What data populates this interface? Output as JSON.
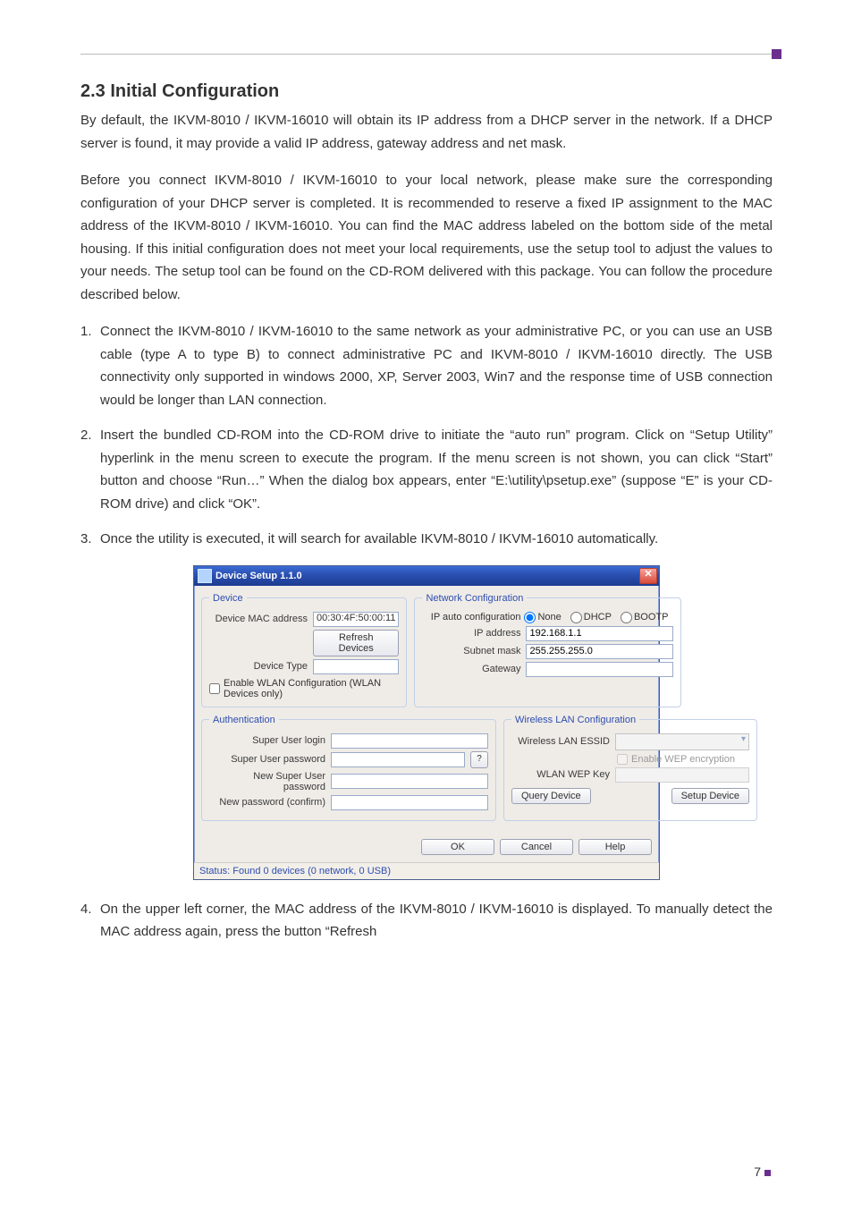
{
  "section": {
    "heading": "2.3 Initial Configuration",
    "para1": "By default, the IKVM-8010 / IKVM-16010 will obtain its IP address from a DHCP server in the network. If a DHCP server is found, it may provide a valid IP address, gateway address and net mask.",
    "para2": "Before you connect IKVM-8010 / IKVM-16010 to your local network, please make sure the corresponding configuration of your DHCP server is completed. It is recommended to reserve a fixed IP assignment to the MAC address of the IKVM-8010 / IKVM-16010. You can find the MAC address labeled on the bottom side of the metal housing. If this initial configuration does not meet your local requirements, use the setup tool to adjust the values to your needs. The setup tool can be found on the CD-ROM delivered with this package. You can follow the procedure described below.",
    "step1": "Connect the IKVM-8010 / IKVM-16010 to the same network as your administrative PC, or you can use an USB cable (type A to type B) to connect administrative PC and IKVM-8010 / IKVM-16010 directly. The USB connectivity only supported in windows 2000, XP, Server 2003, Win7 and the response time of USB connection would be longer than LAN connection.",
    "step2": "Insert the bundled CD-ROM into the CD-ROM drive to initiate the “auto run” program. Click on “Setup Utility” hyperlink in the menu screen to execute the program. If the menu screen is not shown, you can click “Start” button and choose “Run…” When the dialog box appears, enter “E:\\utility\\psetup.exe” (suppose “E” is your CD-ROM drive) and click “OK”.",
    "step3": "Once the utility is executed, it will search for available IKVM-8010 / IKVM-16010 automatically.",
    "step4": "On the upper left corner, the MAC address of the IKVM-8010 / IKVM-16010 is displayed. To manually detect the MAC address again, press the button “Refresh"
  },
  "app": {
    "title": "Device Setup 1.1.0",
    "status": "Status: Found 0 devices (0 network, 0 USB)",
    "device": {
      "legend": "Device",
      "mac_label": "Device MAC address",
      "mac_value": "00:30:4F:50:00:11",
      "refresh_btn": "Refresh Devices",
      "type_label": "Device Type",
      "type_value": "",
      "wlan_enable_label": "Enable WLAN Configuration (WLAN Devices only)"
    },
    "network": {
      "legend": "Network Configuration",
      "autoconf_label": "IP auto configuration",
      "opt_none": "None",
      "opt_dhcp": "DHCP",
      "opt_bootp": "BOOTP",
      "ip_label": "IP address",
      "ip_value": "192.168.1.1",
      "mask_label": "Subnet mask",
      "mask_value": "255.255.255.0",
      "gw_label": "Gateway",
      "gw_value": ""
    },
    "auth": {
      "legend": "Authentication",
      "login_label": "Super User login",
      "pw_label": "Super User password",
      "pw_show": "?",
      "newpw_label": "New Super User password",
      "confirmpw_label": "New password (confirm)"
    },
    "wlan": {
      "legend": "Wireless LAN Configuration",
      "essid_label": "Wireless LAN ESSID",
      "wep_enable_label": "Enable WEP encryption",
      "wep_key_label": "WLAN WEP Key",
      "query_btn": "Query Device",
      "setup_btn": "Setup Device"
    },
    "buttons": {
      "ok": "OK",
      "cancel": "Cancel",
      "help": "Help"
    }
  },
  "page_number": "7"
}
